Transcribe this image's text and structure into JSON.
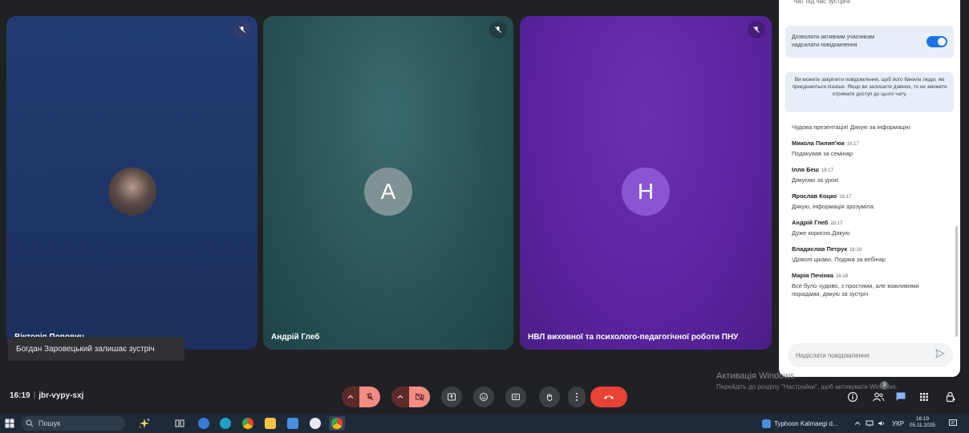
{
  "tiles": [
    {
      "name": "Вікторія Попович",
      "avatar_letter": "",
      "color": "#233b73"
    },
    {
      "name": "Андрій Глеб",
      "avatar_letter": "A",
      "color": "#2a5357"
    },
    {
      "name": "НВЛ виховної та психолого-педагогічної роботи ПНУ",
      "avatar_letter": "H",
      "color": "#5a249f"
    }
  ],
  "toast": "Богдан Заровецький залишає зустріч",
  "chat": {
    "header": "Чат під час зустрічі",
    "allow_label": "Дозволити активним учасникам надсилати повідомлення",
    "allow_enabled": true,
    "info": "Ви можете закріпити повідомлення, щоб його бачили люди, які приєднаються пізніше. Якщо ви залишите дзвінок, то не зможете отримати доступ до цього чату.",
    "first_text": "Чудова презентація! Дякую за інформацію",
    "messages": [
      {
        "author": "Микола Пилип'юк",
        "time": "16:17",
        "text": "Подякував за семінар"
      },
      {
        "author": "Ілля Беш",
        "time": "16:17",
        "text": "Дякуємо за урок!"
      },
      {
        "author": "Ярослав Коцко",
        "time": "16:17",
        "text": "Дякую, інформація зрозуміла."
      },
      {
        "author": "Андрій Глеб",
        "time": "16:17",
        "text": "Дуже корисно.Дякую"
      },
      {
        "author": "Владислав Петрук",
        "time": "16:18",
        "text": "!Доволі цікаво. Подяка за вебінар"
      },
      {
        "author": "Марія Печінка",
        "time": "16:18",
        "text": "Все було чудово, з простими, але важливими порадами, дякую за зустріч"
      }
    ],
    "input_placeholder": "Надіслати повідомлення"
  },
  "watermark": {
    "title": "Активація Windows",
    "subtitle": "Перейдіть до розділу \"Настройки\", щоб активувати Windows."
  },
  "meeting": {
    "time": "16:19",
    "code": "jbr-vypy-sxj"
  },
  "people_count": "3",
  "taskbar": {
    "search": "Пошук",
    "weather": "Typhoon Kalmaegi d...",
    "lang": "УКР",
    "clock_time": "16:19",
    "clock_date": "05.11.2025"
  },
  "colors": {
    "accent": "#1a73e8",
    "end_call": "#ea4335",
    "muted_bg": "#f28b82"
  }
}
